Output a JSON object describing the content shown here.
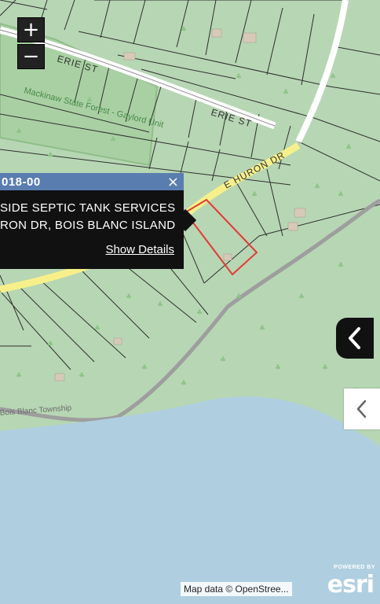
{
  "map": {
    "streets": [
      "ERIE ST",
      "ERIE ST",
      "E HURON DR"
    ],
    "area_label": "Mackinaw State Forest - Gaylord Unit",
    "township_label": "Bois Blanc Township"
  },
  "zoom": {
    "in_label": "+",
    "out_label": "−"
  },
  "popup": {
    "title": "018-00",
    "line1": "SIDE SEPTIC TANK SERVICES",
    "line2": "RON DR, BOIS BLANC ISLAND",
    "details_link": "Show Details",
    "close_label": "×"
  },
  "attribution": "Map data © OpenStree...",
  "logo": {
    "powered": "POWERED BY",
    "name": "esri"
  },
  "colors": {
    "land": "#b7d6b4",
    "water": "#afcfe0",
    "road_major": "#f7f08a",
    "selected_parcel": "#e53935",
    "popup_header": "#5a7db0"
  },
  "icons": {
    "collapse_dark": "chevron-left-icon",
    "collapse_light": "chevron-left-icon",
    "tree_symbol": "tree-icon"
  }
}
